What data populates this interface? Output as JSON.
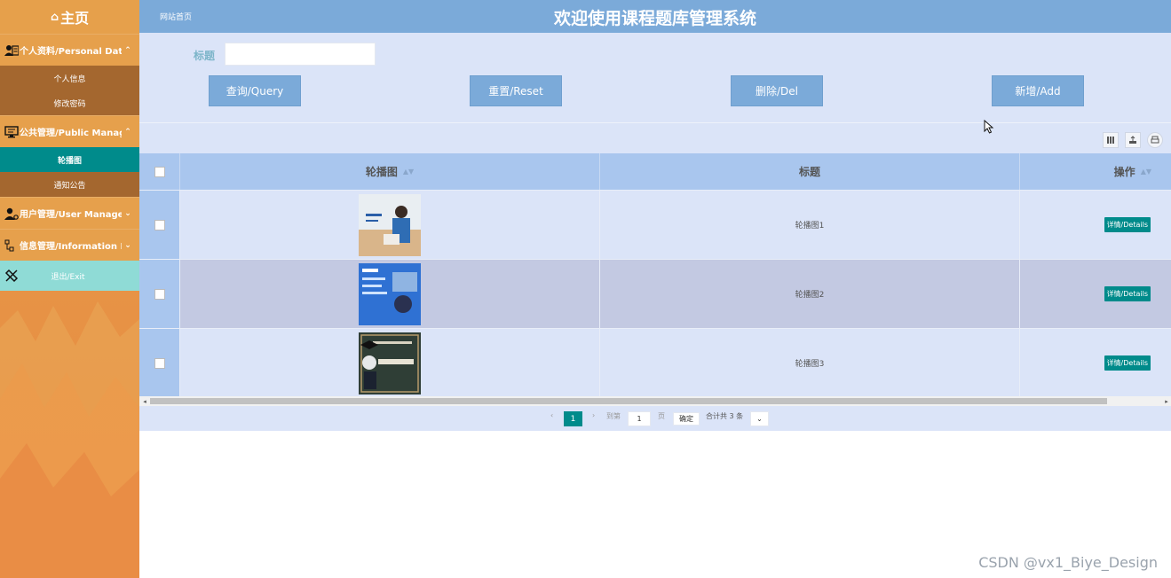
{
  "sidebar": {
    "home_label": "主页",
    "menus": [
      {
        "label": "个人资料/Personal Data",
        "chevron": "up",
        "items": [
          "个人信息",
          "修改密码"
        ]
      },
      {
        "label": "公共管理/Public Manage",
        "chevron": "up",
        "items": [
          "轮播图",
          "通知公告"
        ],
        "active": "轮播图"
      },
      {
        "label": "用户管理/User Manage",
        "chevron": "down",
        "items": []
      },
      {
        "label": "信息管理/Information Manage",
        "chevron": "down",
        "items": []
      }
    ],
    "exit_label": "退出/Exit"
  },
  "topbar": {
    "site_link": "网站首页",
    "title": "欢迎使用课程题库管理系统"
  },
  "search": {
    "field_label": "标题",
    "field_value": "",
    "buttons": {
      "query": "查询/Query",
      "reset": "重置/Reset",
      "delete": "删除/Del",
      "add": "新增/Add"
    }
  },
  "toolbar": {
    "icons": [
      "columns-icon",
      "export-icon",
      "print-icon"
    ]
  },
  "table": {
    "headers": {
      "image": "轮播图",
      "title": "标题",
      "actions": "操作"
    },
    "rows": [
      {
        "title": "轮播图1",
        "action": "详情/Details"
      },
      {
        "title": "轮播图2",
        "action": "详情/Details"
      },
      {
        "title": "轮播图3",
        "action": "详情/Details"
      }
    ]
  },
  "pagination": {
    "current": "1",
    "goto_label": "到第",
    "goto_value": "1",
    "page_unit": "页",
    "confirm": "确定",
    "total": "合计共 3 条"
  },
  "watermark": "CSDN @vx1_Biye_Design",
  "colors": {
    "sidebar": "#e79a47",
    "accent_teal": "#008b8b",
    "header_blue": "#7baad9",
    "panel_bg": "#dbe4f8",
    "table_head": "#a9c6ee"
  }
}
